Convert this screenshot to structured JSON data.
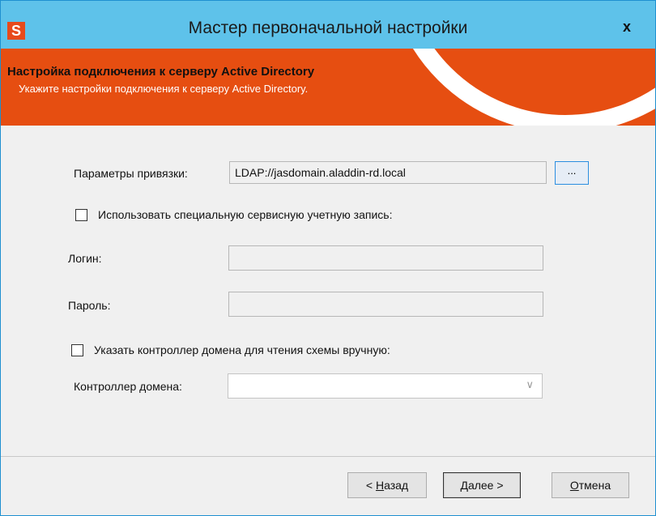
{
  "window": {
    "app_icon_letter": "S",
    "title": "Мастер первоначальной настройки",
    "close_label": "x"
  },
  "banner": {
    "title": "Настройка подключения к серверу Active Directory",
    "subtitle": "Укажите настройки подключения к серверу Active Directory."
  },
  "form": {
    "bind_label": "Параметры привязки:",
    "bind_value": "LDAP://jasdomain.aladdin-rd.local",
    "browse_label": "...",
    "service_account_checkbox": {
      "label": "Использовать специальную сервисную учетную запись:",
      "checked": false
    },
    "login_label": "Логин:",
    "login_value": "",
    "password_label": "Пароль:",
    "password_value": "",
    "manual_dc_checkbox": {
      "label": "Указать контроллер домена для чтения схемы вручную:",
      "checked": false
    },
    "dc_label": "Контроллер домена:",
    "dc_value": ""
  },
  "buttons": {
    "back_prefix": "< ",
    "back_accel": "Н",
    "back_rest": "азад",
    "next_accel": "Д",
    "next_rest": "алее >",
    "cancel_accel": "О",
    "cancel_rest": "тмена"
  },
  "colors": {
    "titlebar": "#5ec2ea",
    "banner": "#e64e11",
    "app_icon": "#e74a1b"
  }
}
